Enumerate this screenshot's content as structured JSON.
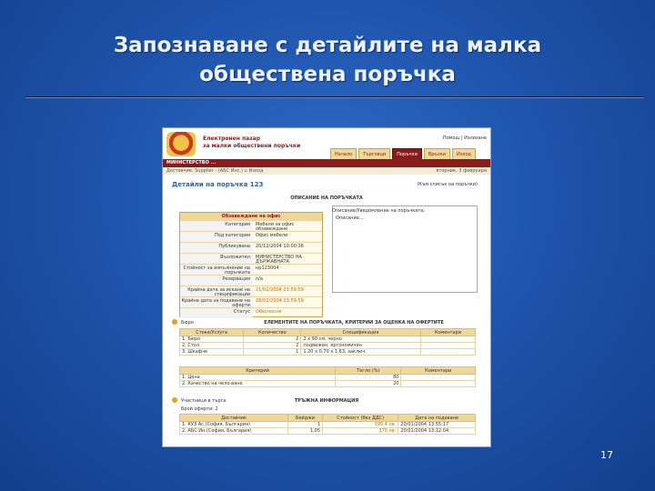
{
  "slide": {
    "title_line1": "Запознаване с детайлите на малка",
    "title_line2": "обществена поръчка",
    "page_number": "17"
  },
  "screenshot": {
    "brand_line1": "Електронен пазар",
    "brand_line2": "за малки обществени поръчки",
    "user_links": "Помощ | Излизане",
    "tabs": [
      {
        "label": "Начало",
        "active": false
      },
      {
        "label": "Търговци",
        "active": false
      },
      {
        "label": "Поръчки",
        "active": true
      },
      {
        "label": "Връзки",
        "active": false
      },
      {
        "label": "Изход",
        "active": false
      }
    ],
    "section_bar": "МИНИСТЕРСТВО ...",
    "supplier_line": "Доставчик: Supplier - (АБС Инс.)   ▫ Изход",
    "date_line": "вторник, 3 февруари",
    "page_title": "Детайли на поръчка 123",
    "back_link": "(Към списък на поръчки)",
    "description_title": "ОПИСАНИЕ НА ПОРЪЧКАТА",
    "description_box_head": "Обзавеждане на офис",
    "description_rows": [
      {
        "key": "Категория",
        "value": "Мебели за офис обзавеждане",
        "highlight": false
      },
      {
        "key": "Под категория",
        "value": "Офис мебели",
        "highlight": false
      },
      {
        "key": "Публикувана",
        "value": "20/12/2004 10:00:36",
        "highlight": false
      },
      {
        "key": "Възложител",
        "value": "МИНИСТЕРСТВО НА ДЪРЖАВНАТА",
        "highlight": false
      },
      {
        "key": "Стойност за изпълнение на поръчката",
        "value": "нр123004",
        "highlight": false
      },
      {
        "key": "Резервация",
        "value": "n/a",
        "highlight": false
      },
      {
        "key": "Крайна дата за искане на спецификации",
        "value": "21/02/2004 23:59:59",
        "highlight": true
      },
      {
        "key": "Крайна дата за подаване на оферти",
        "value": "28/02/2004 23:59:59",
        "highlight": true
      },
      {
        "key": "Статус",
        "value": "Обесносне",
        "highlight": true
      }
    ],
    "remarks_label": "Описание/Уведомление на поръчката:",
    "remarks_value": "Описание...",
    "items_icon_label": "Бюро",
    "items_title": "ЕЛЕМЕНТИТЕ НА ПОРЪЧКАТА, КРИТЕРИИ ЗА ОЦЕНКА НА ОФЕРТИТЕ",
    "items_headers": [
      "Стока/Услуга",
      "Количество",
      "Спецификация",
      "Коментари"
    ],
    "items_rows": [
      [
        "1. Бюро",
        "2",
        "2 x 90 см, черно",
        ""
      ],
      [
        "2. Стол",
        "2",
        "подвижен, ергономичен",
        ""
      ],
      [
        "3. Шкафче",
        "1",
        "1,20 х 0,70 х 1,63, заключ.",
        ""
      ]
    ],
    "criteria_headers": [
      "Критерий",
      "Тегло (%)",
      "Коментари"
    ],
    "criteria_rows": [
      [
        "1. Цена",
        "80",
        ""
      ],
      [
        "2. Качество на чело-ване",
        "20",
        ""
      ]
    ],
    "offers_icon_label": "Участници в търга",
    "offers_title": "ТРЪЖНА ИНФОРМАЦИЯ",
    "offers_count": "Брой оферти: 2",
    "offers_headers": [
      "Доставчик",
      "Бейджи",
      "Стойност (без ДДС)",
      "Дата на подаване"
    ],
    "offers_rows": [
      [
        "1. КУЗ Ас.(София, България)",
        "1",
        "395,4 лв.",
        "20/01/2004 13:55:17"
      ],
      [
        "2. АБС Ин.(София, България)",
        "1,05",
        "375 лв.",
        "20/01/2004 13:12:04"
      ]
    ]
  }
}
